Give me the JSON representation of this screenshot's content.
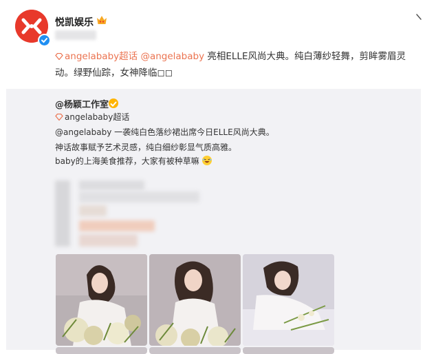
{
  "account": {
    "name": "悦凯娱乐",
    "verified": true
  },
  "post": {
    "supertopic_link": "angelababy超话",
    "mention_link": "@angelababy",
    "text": " 亮相ELLE风尚大典。纯白薄纱轻舞，剪眸雾眉灵动。绿野仙踪，女神降临◻◻"
  },
  "quote": {
    "author": "@杨颖工作室",
    "supertopic_link": "angelababy超话",
    "line1_mention": "@angelababy",
    "line1_text": " 一袭纯白色落纱裙出席今日ELLE风尚大典。",
    "line2": "神话故事赋予艺术灵感，纯白细纱彰显气质高雅。",
    "line3": "baby的上海美食推荐，大家有被种草嘛"
  },
  "icons": {
    "avatar": "yuekai-logo-icon",
    "verified": "verified-icon",
    "dropdown": "chevron-down-icon",
    "supertopic": "gem-icon",
    "emoji": "laugh-emoji-icon"
  },
  "colors": {
    "link": "#eb7350",
    "brand_red": "#e8392b",
    "verified_blue": "#1f8ff2",
    "quote_bg": "#f2f2f5"
  }
}
